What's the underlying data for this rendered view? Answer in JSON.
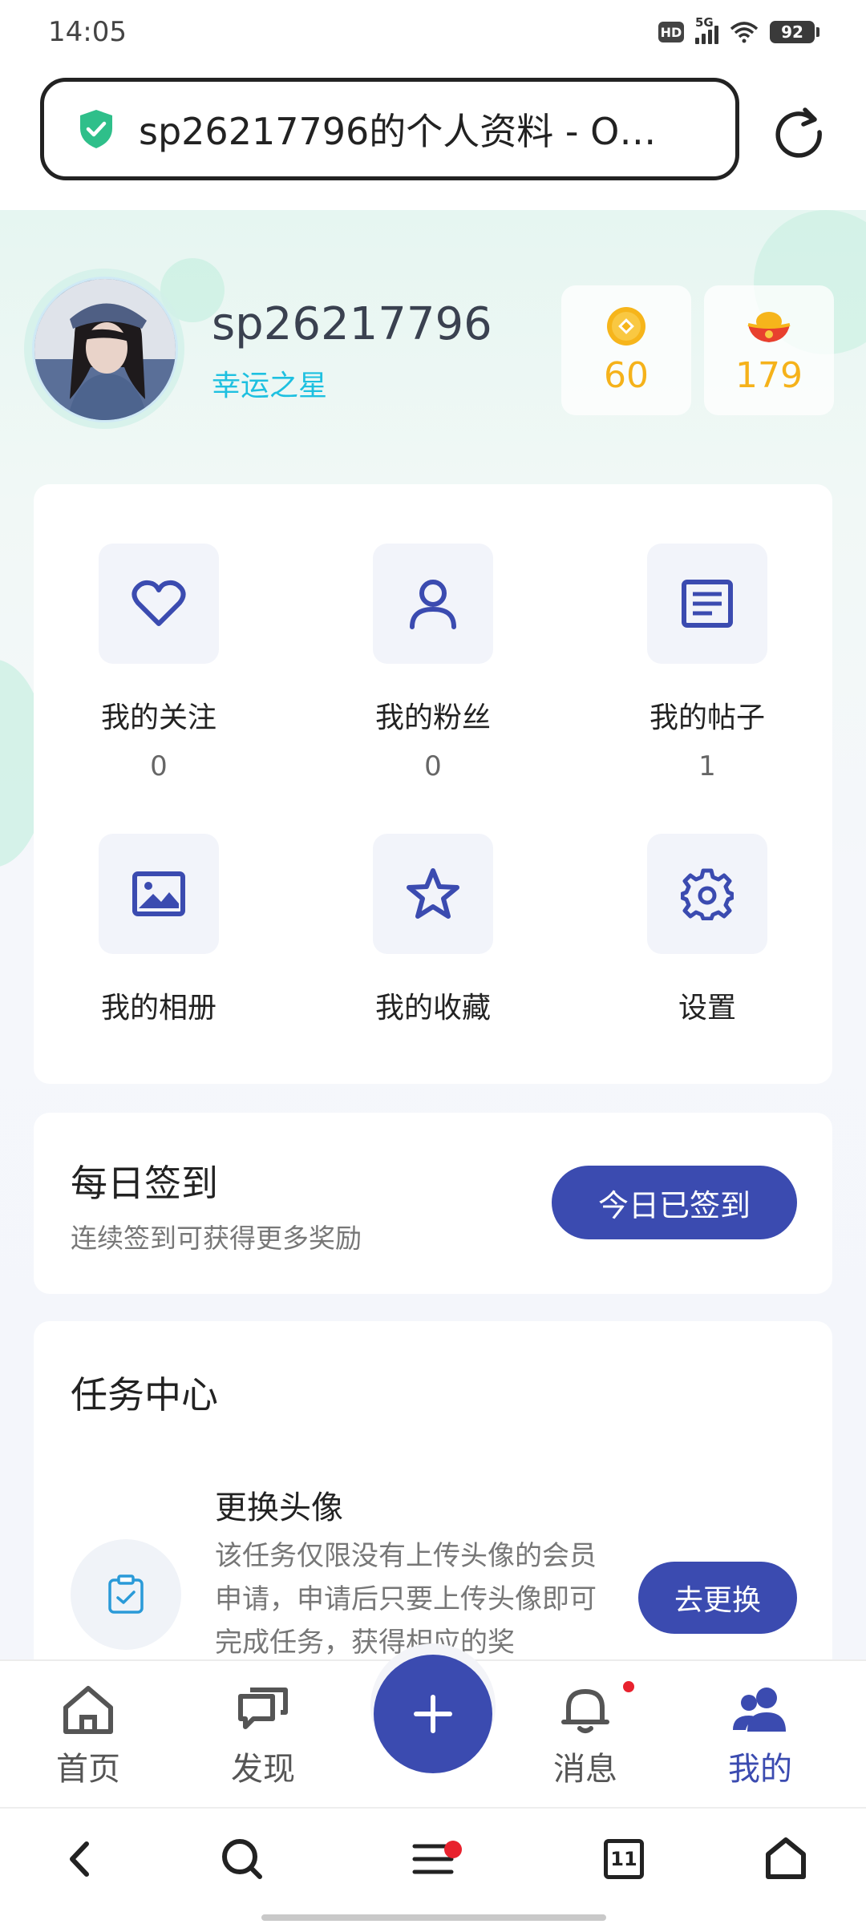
{
  "status_bar": {
    "time": "14:05",
    "hd": "HD",
    "network": "5G",
    "battery": "92"
  },
  "url_bar": {
    "text": "sp26217796的个人资料 - O…"
  },
  "profile": {
    "username": "sp26217796",
    "title": "幸运之星",
    "coins": "60",
    "ingots": "179"
  },
  "menu": [
    {
      "label": "我的关注",
      "count": "0",
      "icon": "heart-icon"
    },
    {
      "label": "我的粉丝",
      "count": "0",
      "icon": "person-icon"
    },
    {
      "label": "我的帖子",
      "count": "1",
      "icon": "document-icon"
    },
    {
      "label": "我的相册",
      "icon": "image-icon"
    },
    {
      "label": "我的收藏",
      "icon": "star-icon"
    },
    {
      "label": "设置",
      "icon": "gear-icon"
    }
  ],
  "checkin": {
    "title": "每日签到",
    "subtitle": "连续签到可获得更多奖励",
    "button": "今日已签到"
  },
  "tasks": {
    "heading": "任务中心",
    "items": [
      {
        "title": "更换头像",
        "description": "该任务仅限没有上传头像的会员申请，申请后只要上传头像即可完成任务，获得相应的奖",
        "button": "去更换"
      }
    ]
  },
  "bottom_nav": [
    {
      "label": "首页",
      "icon": "home-icon"
    },
    {
      "label": "发现",
      "icon": "chat-icon"
    },
    {
      "label": "消息",
      "icon": "bell-icon"
    },
    {
      "label": "我的",
      "icon": "users-icon",
      "active": true
    }
  ],
  "browser_bar": {
    "tab_count": "11"
  },
  "colors": {
    "accent": "#3b4bb0",
    "coin": "#f5b21a",
    "title_cyan": "#1ec0e0",
    "notification": "#e8222e"
  }
}
